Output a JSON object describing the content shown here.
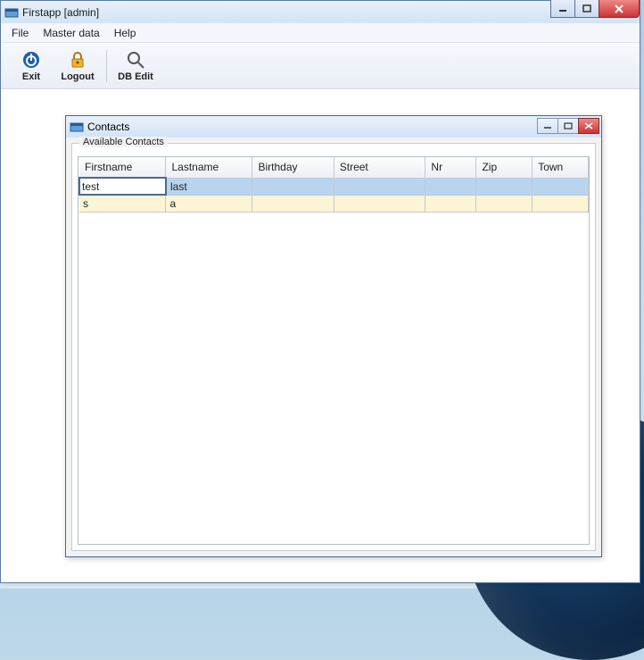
{
  "outer": {
    "title": "Firstapp [admin]"
  },
  "menu": {
    "file": "File",
    "masterdata": "Master data",
    "help": "Help"
  },
  "toolbar": {
    "exit": "Exit",
    "logout": "Logout",
    "dbedit": "DB Edit"
  },
  "inner": {
    "title": "Contacts",
    "group": "Available Contacts"
  },
  "table": {
    "headers": {
      "firstname": "Firstname",
      "lastname": "Lastname",
      "birthday": "Birthday",
      "street": "Street",
      "nr": "Nr",
      "zip": "Zip",
      "town": "Town"
    },
    "rows": [
      {
        "firstname": "test",
        "lastname": "last",
        "birthday": "",
        "street": "",
        "nr": "",
        "zip": "",
        "town": ""
      },
      {
        "firstname": "s",
        "lastname": "a",
        "birthday": "",
        "street": "",
        "nr": "",
        "zip": "",
        "town": ""
      }
    ]
  }
}
